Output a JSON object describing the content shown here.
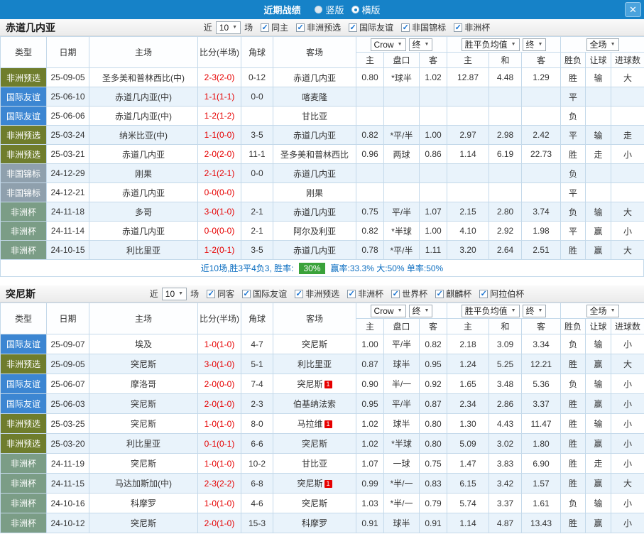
{
  "titlebar": {
    "title": "近期战绩",
    "layout_options": [
      {
        "label": "竖版",
        "selected": false
      },
      {
        "label": "横版",
        "selected": true
      }
    ],
    "close_label": "✕"
  },
  "table_header": {
    "col_type": "类型",
    "col_date": "日期",
    "col_home": "主场",
    "col_score": "比分(半场)",
    "col_corner": "角球",
    "col_away": "客场",
    "odds_group": {
      "source": "Crow",
      "state": "终",
      "col_home": "主",
      "col_handicap": "盘口",
      "col_away": "客"
    },
    "avg_group": {
      "label": "胜平负均值",
      "state": "终",
      "col_home": "主",
      "col_draw": "和",
      "col_away": "客"
    },
    "result_group": {
      "scope": "全场",
      "col_result": "胜负",
      "col_handicap": "让球",
      "col_goals": "进球数"
    }
  },
  "type_colors": {
    "非洲预选": "#6f7d2d",
    "国际友谊": "#3c86d2",
    "非国锦标": "#8fa0ad",
    "非洲杯": "#7b9d86"
  },
  "sections": [
    {
      "team": "赤道几内亚",
      "recent": {
        "prefix": "近",
        "count": "10",
        "suffix": "场"
      },
      "filters": [
        "同主",
        "非洲预选",
        "国际友谊",
        "非国锦标",
        "非洲杯"
      ],
      "rows": [
        {
          "type": "非洲预选",
          "date": "25-09-05",
          "home": "圣多美和普林西比(中)",
          "home_cls": "",
          "home_badge": "",
          "score": "2-3",
          "half": "(2-0)",
          "corners": "0-12",
          "away": "赤道几内亚",
          "away_cls": "green",
          "away_badge": "",
          "o_home": "0.80",
          "handicap": "*球半",
          "handicap_red": true,
          "o_away": "1.02",
          "avg_home": "12.87",
          "avg_draw": "4.48",
          "avg_away": "1.29",
          "result": "胜",
          "result_cls": "red",
          "let_res": "输",
          "let_cls": "green",
          "goal_res": "大",
          "goal_cls": "red"
        },
        {
          "type": "国际友谊",
          "date": "25-06-10",
          "home": "赤道几内亚(中)",
          "home_cls": "green",
          "home_badge": "",
          "score": "1-1",
          "half": "(1-1)",
          "corners": "0-0",
          "away": "喀麦隆",
          "away_cls": "",
          "away_badge": "",
          "o_home": "",
          "handicap": "",
          "handicap_red": false,
          "o_away": "",
          "avg_home": "",
          "avg_draw": "",
          "avg_away": "",
          "result": "平",
          "result_cls": "blue",
          "let_res": "",
          "let_cls": "",
          "goal_res": "",
          "goal_cls": ""
        },
        {
          "type": "国际友谊",
          "date": "25-06-06",
          "home": "赤道几内亚(中)",
          "home_cls": "green",
          "home_badge": "",
          "score": "1-2",
          "half": "(1-2)",
          "corners": "",
          "away": "甘比亚",
          "away_cls": "",
          "away_badge": "",
          "o_home": "",
          "handicap": "",
          "handicap_red": false,
          "o_away": "",
          "avg_home": "",
          "avg_draw": "",
          "avg_away": "",
          "result": "负",
          "result_cls": "green",
          "let_res": "",
          "let_cls": "",
          "goal_res": "",
          "goal_cls": ""
        },
        {
          "type": "非洲预选",
          "date": "25-03-24",
          "home": "纳米比亚(中)",
          "home_cls": "",
          "home_badge": "",
          "score": "1-1",
          "half": "(0-0)",
          "corners": "3-5",
          "away": "赤道几内亚",
          "away_cls": "green",
          "away_badge": "",
          "o_home": "0.82",
          "handicap": "*平/半",
          "handicap_red": true,
          "o_away": "1.00",
          "avg_home": "2.97",
          "avg_draw": "2.98",
          "avg_away": "2.42",
          "result": "平",
          "result_cls": "blue",
          "let_res": "输",
          "let_cls": "green",
          "goal_res": "走",
          "goal_cls": "red"
        },
        {
          "type": "非洲预选",
          "date": "25-03-21",
          "home": "赤道几内亚",
          "home_cls": "green",
          "home_badge": "",
          "score": "2-0",
          "half": "(2-0)",
          "corners": "11-1",
          "away": "圣多美和普林西比",
          "away_cls": "",
          "away_badge": "",
          "o_home": "0.96",
          "handicap": "两球",
          "handicap_red": false,
          "o_away": "0.86",
          "avg_home": "1.14",
          "avg_draw": "6.19",
          "avg_away": "22.73",
          "result": "胜",
          "result_cls": "red",
          "let_res": "走",
          "let_cls": "red",
          "goal_res": "小",
          "goal_cls": "green"
        },
        {
          "type": "非国锦标",
          "date": "24-12-29",
          "home": "刚果",
          "home_cls": "",
          "home_badge": "",
          "score": "2-1",
          "half": "(2-1)",
          "corners": "0-0",
          "away": "赤道几内亚",
          "away_cls": "green",
          "away_badge": "",
          "o_home": "",
          "handicap": "",
          "handicap_red": false,
          "o_away": "",
          "avg_home": "",
          "avg_draw": "",
          "avg_away": "",
          "result": "负",
          "result_cls": "green",
          "let_res": "",
          "let_cls": "",
          "goal_res": "",
          "goal_cls": ""
        },
        {
          "type": "非国锦标",
          "date": "24-12-21",
          "home": "赤道几内亚",
          "home_cls": "green",
          "home_badge": "",
          "score": "0-0",
          "half": "(0-0)",
          "corners": "",
          "away": "刚果",
          "away_cls": "",
          "away_badge": "",
          "o_home": "",
          "handicap": "",
          "handicap_red": false,
          "o_away": "",
          "avg_home": "",
          "avg_draw": "",
          "avg_away": "",
          "result": "平",
          "result_cls": "blue",
          "let_res": "",
          "let_cls": "",
          "goal_res": "",
          "goal_cls": ""
        },
        {
          "type": "非洲杯",
          "date": "24-11-18",
          "home": "多哥",
          "home_cls": "",
          "home_badge": "",
          "score": "3-0",
          "half": "(1-0)",
          "corners": "2-1",
          "away": "赤道几内亚",
          "away_cls": "green",
          "away_badge": "",
          "o_home": "0.75",
          "handicap": "平/半",
          "handicap_red": false,
          "o_away": "1.07",
          "avg_home": "2.15",
          "avg_draw": "2.80",
          "avg_away": "3.74",
          "result": "负",
          "result_cls": "green",
          "let_res": "输",
          "let_cls": "green",
          "goal_res": "大",
          "goal_cls": "red"
        },
        {
          "type": "非洲杯",
          "date": "24-11-14",
          "home": "赤道几内亚",
          "home_cls": "green",
          "home_badge": "",
          "score": "0-0",
          "half": "(0-0)",
          "corners": "2-1",
          "away": "阿尔及利亚",
          "away_cls": "",
          "away_badge": "",
          "o_home": "0.82",
          "handicap": "*半球",
          "handicap_red": true,
          "o_away": "1.00",
          "avg_home": "4.10",
          "avg_draw": "2.92",
          "avg_away": "1.98",
          "result": "平",
          "result_cls": "blue",
          "let_res": "赢",
          "let_cls": "red",
          "goal_res": "小",
          "goal_cls": "green"
        },
        {
          "type": "非洲杯",
          "date": "24-10-15",
          "home": "利比里亚",
          "home_cls": "",
          "home_badge": "",
          "score": "1-2",
          "half": "(0-1)",
          "corners": "3-5",
          "away": "赤道几内亚",
          "away_cls": "green",
          "away_badge": "",
          "o_home": "0.78",
          "handicap": "*平/半",
          "handicap_red": true,
          "o_away": "1.11",
          "avg_home": "3.20",
          "avg_draw": "2.64",
          "avg_away": "2.51",
          "result": "胜",
          "result_cls": "red",
          "let_res": "赢",
          "let_cls": "red",
          "goal_res": "大",
          "goal_cls": "red"
        }
      ],
      "footer": {
        "prefix": "近10场,胜3平4负3, 胜率:",
        "win_rate": "30%",
        "suffix": "赢率:33.3% 大:50% 单率:50%"
      }
    },
    {
      "team": "突尼斯",
      "recent": {
        "prefix": "近",
        "count": "10",
        "suffix": "场"
      },
      "filters": [
        "同客",
        "国际友谊",
        "非洲预选",
        "非洲杯",
        "世界杯",
        "麒麟杯",
        "阿拉伯杯"
      ],
      "rows": [
        {
          "type": "国际友谊",
          "date": "25-09-07",
          "home": "埃及",
          "home_cls": "",
          "home_badge": "",
          "score": "1-0",
          "half": "(1-0)",
          "corners": "4-7",
          "away": "突尼斯",
          "away_cls": "red",
          "away_badge": "",
          "o_home": "1.00",
          "handicap": "平/半",
          "handicap_red": false,
          "o_away": "0.82",
          "avg_home": "2.18",
          "avg_draw": "3.09",
          "avg_away": "3.34",
          "result": "负",
          "result_cls": "green",
          "let_res": "输",
          "let_cls": "green",
          "goal_res": "小",
          "goal_cls": "green"
        },
        {
          "type": "非洲预选",
          "date": "25-09-05",
          "home": "突尼斯",
          "home_cls": "red",
          "home_badge": "",
          "score": "3-0",
          "half": "(1-0)",
          "corners": "5-1",
          "away": "利比里亚",
          "away_cls": "",
          "away_badge": "",
          "o_home": "0.87",
          "handicap": "球半",
          "handicap_red": false,
          "o_away": "0.95",
          "avg_home": "1.24",
          "avg_draw": "5.25",
          "avg_away": "12.21",
          "result": "胜",
          "result_cls": "red",
          "let_res": "赢",
          "let_cls": "red",
          "goal_res": "大",
          "goal_cls": "red"
        },
        {
          "type": "国际友谊",
          "date": "25-06-07",
          "home": "摩洛哥",
          "home_cls": "",
          "home_badge": "",
          "score": "2-0",
          "half": "(0-0)",
          "corners": "7-4",
          "away": "突尼斯",
          "away_cls": "red",
          "away_badge": "1",
          "o_home": "0.90",
          "handicap": "半/一",
          "handicap_red": true,
          "o_away": "0.92",
          "avg_home": "1.65",
          "avg_draw": "3.48",
          "avg_away": "5.36",
          "result": "负",
          "result_cls": "green",
          "let_res": "输",
          "let_cls": "green",
          "goal_res": "小",
          "goal_cls": "green"
        },
        {
          "type": "国际友谊",
          "date": "25-06-03",
          "home": "突尼斯",
          "home_cls": "red",
          "home_badge": "",
          "score": "2-0",
          "half": "(1-0)",
          "corners": "2-3",
          "away": "伯基纳法索",
          "away_cls": "",
          "away_badge": "",
          "o_home": "0.95",
          "handicap": "平/半",
          "handicap_red": false,
          "o_away": "0.87",
          "avg_home": "2.34",
          "avg_draw": "2.86",
          "avg_away": "3.37",
          "result": "胜",
          "result_cls": "red",
          "let_res": "赢",
          "let_cls": "red",
          "goal_res": "小",
          "goal_cls": "green"
        },
        {
          "type": "非洲预选",
          "date": "25-03-25",
          "home": "突尼斯",
          "home_cls": "red",
          "home_badge": "",
          "score": "1-0",
          "half": "(1-0)",
          "corners": "8-0",
          "away": "马拉维",
          "away_cls": "",
          "away_badge": "1",
          "o_home": "1.02",
          "handicap": "球半",
          "handicap_red": false,
          "o_away": "0.80",
          "avg_home": "1.30",
          "avg_draw": "4.43",
          "avg_away": "11.47",
          "result": "胜",
          "result_cls": "red",
          "let_res": "输",
          "let_cls": "green",
          "goal_res": "小",
          "goal_cls": "green"
        },
        {
          "type": "非洲预选",
          "date": "25-03-20",
          "home": "利比里亚",
          "home_cls": "",
          "home_badge": "",
          "score": "0-1",
          "half": "(0-1)",
          "corners": "6-6",
          "away": "突尼斯",
          "away_cls": "red",
          "away_badge": "",
          "o_home": "1.02",
          "handicap": "*半球",
          "handicap_red": true,
          "o_away": "0.80",
          "avg_home": "5.09",
          "avg_draw": "3.02",
          "avg_away": "1.80",
          "result": "胜",
          "result_cls": "red",
          "let_res": "赢",
          "let_cls": "red",
          "goal_res": "小",
          "goal_cls": "green"
        },
        {
          "type": "非洲杯",
          "date": "24-11-19",
          "home": "突尼斯",
          "home_cls": "red",
          "home_badge": "",
          "score": "1-0",
          "half": "(1-0)",
          "corners": "10-2",
          "away": "甘比亚",
          "away_cls": "",
          "away_badge": "",
          "o_home": "1.07",
          "handicap": "一球",
          "handicap_red": false,
          "o_away": "0.75",
          "avg_home": "1.47",
          "avg_draw": "3.83",
          "avg_away": "6.90",
          "result": "胜",
          "result_cls": "red",
          "let_res": "走",
          "let_cls": "red",
          "goal_res": "小",
          "goal_cls": "green"
        },
        {
          "type": "非洲杯",
          "date": "24-11-15",
          "home": "马达加斯加(中)",
          "home_cls": "",
          "home_badge": "",
          "score": "2-3",
          "half": "(2-2)",
          "corners": "6-8",
          "away": "突尼斯",
          "away_cls": "red",
          "away_badge": "1",
          "o_home": "0.99",
          "handicap": "*半/一",
          "handicap_red": true,
          "o_away": "0.83",
          "avg_home": "6.15",
          "avg_draw": "3.42",
          "avg_away": "1.57",
          "result": "胜",
          "result_cls": "red",
          "let_res": "赢",
          "let_cls": "red",
          "goal_res": "大",
          "goal_cls": "red"
        },
        {
          "type": "非洲杯",
          "date": "24-10-16",
          "home": "科摩罗",
          "home_cls": "",
          "home_badge": "",
          "score": "1-0",
          "half": "(1-0)",
          "corners": "4-6",
          "away": "突尼斯",
          "away_cls": "red",
          "away_badge": "",
          "o_home": "1.03",
          "handicap": "*半/一",
          "handicap_red": true,
          "o_away": "0.79",
          "avg_home": "5.74",
          "avg_draw": "3.37",
          "avg_away": "1.61",
          "result": "负",
          "result_cls": "green",
          "let_res": "输",
          "let_cls": "green",
          "goal_res": "小",
          "goal_cls": "green"
        },
        {
          "type": "非洲杯",
          "date": "24-10-12",
          "home": "突尼斯",
          "home_cls": "red",
          "home_badge": "",
          "score": "2-0",
          "half": "(1-0)",
          "corners": "15-3",
          "away": "科摩罗",
          "away_cls": "",
          "away_badge": "",
          "o_home": "0.91",
          "handicap": "球半",
          "handicap_red": false,
          "o_away": "0.91",
          "avg_home": "1.14",
          "avg_draw": "4.87",
          "avg_away": "13.43",
          "result": "胜",
          "result_cls": "red",
          "let_res": "赢",
          "let_cls": "red",
          "goal_res": "小",
          "goal_cls": "green"
        }
      ],
      "footer": null
    }
  ]
}
